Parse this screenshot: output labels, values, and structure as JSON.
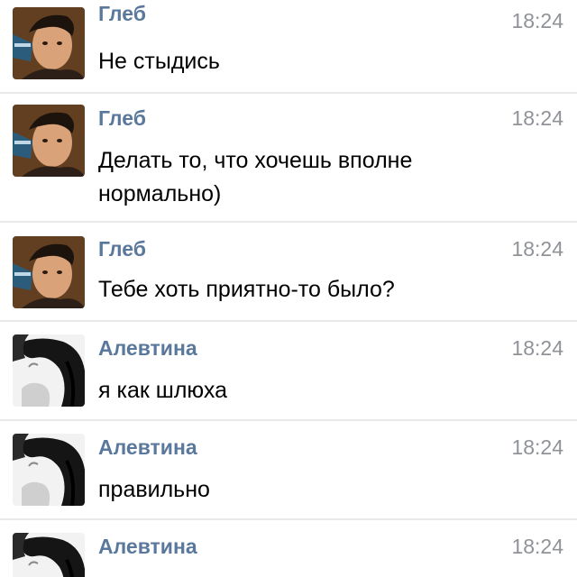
{
  "messages": [
    {
      "sender": "Глеб",
      "time": "18:24",
      "text": "Не стыдись",
      "avatar": "gleb-photo"
    },
    {
      "sender": "Глеб",
      "time": "18:24",
      "text": "Делать то, что хочешь вполне нормально)",
      "avatar": "gleb-photo"
    },
    {
      "sender": "Глеб",
      "time": "18:24",
      "text": "Тебе хоть приятно-то было?",
      "avatar": "gleb-photo"
    },
    {
      "sender": "Алевтина",
      "time": "18:24",
      "text": "я как шлюха",
      "avatar": "alevtina-photo"
    },
    {
      "sender": "Алевтина",
      "time": "18:24",
      "text": "правильно",
      "avatar": "alevtina-photo"
    },
    {
      "sender": "Алевтина",
      "time": "18:24",
      "text": "",
      "avatar": "alevtina-photo"
    }
  ],
  "colors": {
    "sender_name": "#5a779c",
    "timestamp": "#8f9397",
    "message_text": "#000000",
    "divider": "#e8e9eb",
    "background": "#ffffff"
  }
}
